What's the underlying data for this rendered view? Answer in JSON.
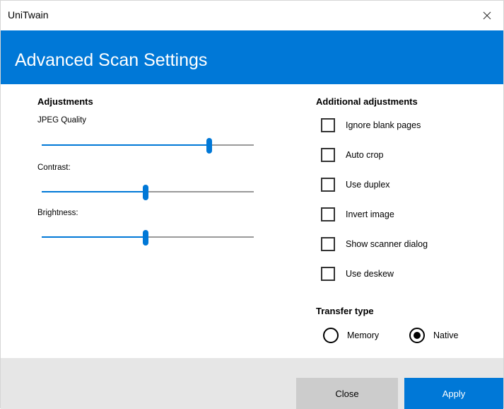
{
  "window": {
    "title": "UniTwain",
    "close_icon": "close-icon"
  },
  "banner": {
    "heading": "Advanced Scan Settings",
    "color": "#0078d7"
  },
  "adjustments": {
    "title": "Adjustments",
    "sliders": [
      {
        "label": "JPEG Quality",
        "value_fraction": 0.79
      },
      {
        "label": "Contrast:",
        "value_fraction": 0.49
      },
      {
        "label": "Brightness:",
        "value_fraction": 0.49
      }
    ]
  },
  "additional": {
    "title": "Additional adjustments",
    "checkboxes": [
      {
        "label": "Ignore blank pages",
        "checked": false
      },
      {
        "label": "Auto crop",
        "checked": false
      },
      {
        "label": "Use duplex",
        "checked": false
      },
      {
        "label": "Invert image",
        "checked": false
      },
      {
        "label": "Show scanner dialog",
        "checked": false
      },
      {
        "label": "Use deskew",
        "checked": false
      }
    ]
  },
  "transfer": {
    "title": "Transfer type",
    "options": [
      {
        "label": "Memory",
        "selected": false
      },
      {
        "label": "Native",
        "selected": true
      }
    ]
  },
  "footer": {
    "close_label": "Close",
    "apply_label": "Apply"
  }
}
